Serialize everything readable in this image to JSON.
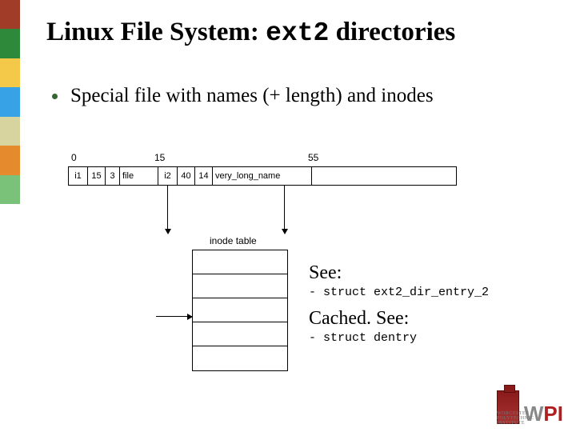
{
  "colors": {
    "bar": [
      "#a03c28",
      "#2e8a3a",
      "#f4c94a",
      "#37a2e6",
      "#d8d4a0",
      "#e68a2e",
      "#7ac27a"
    ]
  },
  "title": {
    "prefix": "Linux File System: ",
    "code": "ext2",
    "suffix": " directories"
  },
  "bullet": "Special file with names (+ length) and inodes",
  "diagram": {
    "offsets": {
      "a": "0",
      "b": "15",
      "c": "55"
    },
    "entry1": {
      "inode": "i1",
      "reclen": "15",
      "namelen": "3",
      "name": "file"
    },
    "entry2": {
      "inode": "i2",
      "reclen": "40",
      "namelen": "14",
      "name": "very_long_name"
    },
    "inode_label": "inode table"
  },
  "notes": {
    "see1": "See:",
    "code1": "- struct ext2_dir_entry_2",
    "see2": "Cached.  See:",
    "code2": "- struct dentry"
  },
  "logo": {
    "w": "W",
    "p": "P",
    "i": "I",
    "sub": "WORCESTER POLYTECHNIC INSTITUTE"
  }
}
